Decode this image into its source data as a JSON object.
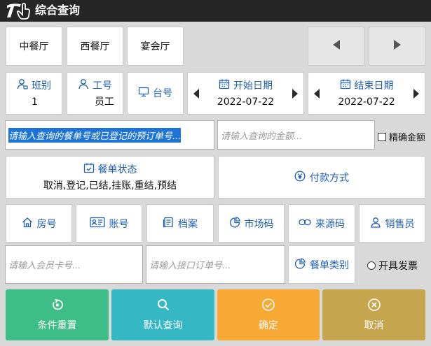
{
  "window": {
    "title": "综合查询",
    "logo_text": "T"
  },
  "halls": [
    "中餐厅",
    "西餐厅",
    "宴会厅"
  ],
  "fields": {
    "shift": {
      "label": "班别",
      "value": "1"
    },
    "employee": {
      "label": "工号",
      "value": "员工"
    },
    "table": {
      "label": "台号"
    },
    "start_date": {
      "label": "开始日期",
      "value": "2022-07-22"
    },
    "end_date": {
      "label": "结束日期",
      "value": "2022-07-22"
    }
  },
  "search": {
    "order_text": "请输入查询的餐单号或已登记的预订单号...",
    "amount_placeholder": "请输入查询的金额...",
    "exact_amount_label": "精确金额",
    "exact_amount_checked": false
  },
  "order_status": {
    "label": "餐单状态",
    "value": "取消,登记,已结,挂账,重结,预结"
  },
  "payment": {
    "label": "付款方式"
  },
  "filters": [
    "房号",
    "账号",
    "档案",
    "市场码",
    "来源码",
    "销售员"
  ],
  "member_card_placeholder": "请输入会员卡号...",
  "interface_order_placeholder": "请输入接口订单号...",
  "order_category_label": "餐单类别",
  "invoice_label": "开具发票",
  "invoice_checked": false,
  "actions": {
    "reset": "条件重置",
    "default_query": "默认查询",
    "confirm": "确定",
    "cancel": "取消"
  },
  "colors": {
    "accent": "#1e5fb4",
    "reset": "#3dbd87",
    "default_query": "#36b8c4",
    "confirm": "#f7a933",
    "cancel": "#c5a64f",
    "titlebar": "#262626"
  }
}
